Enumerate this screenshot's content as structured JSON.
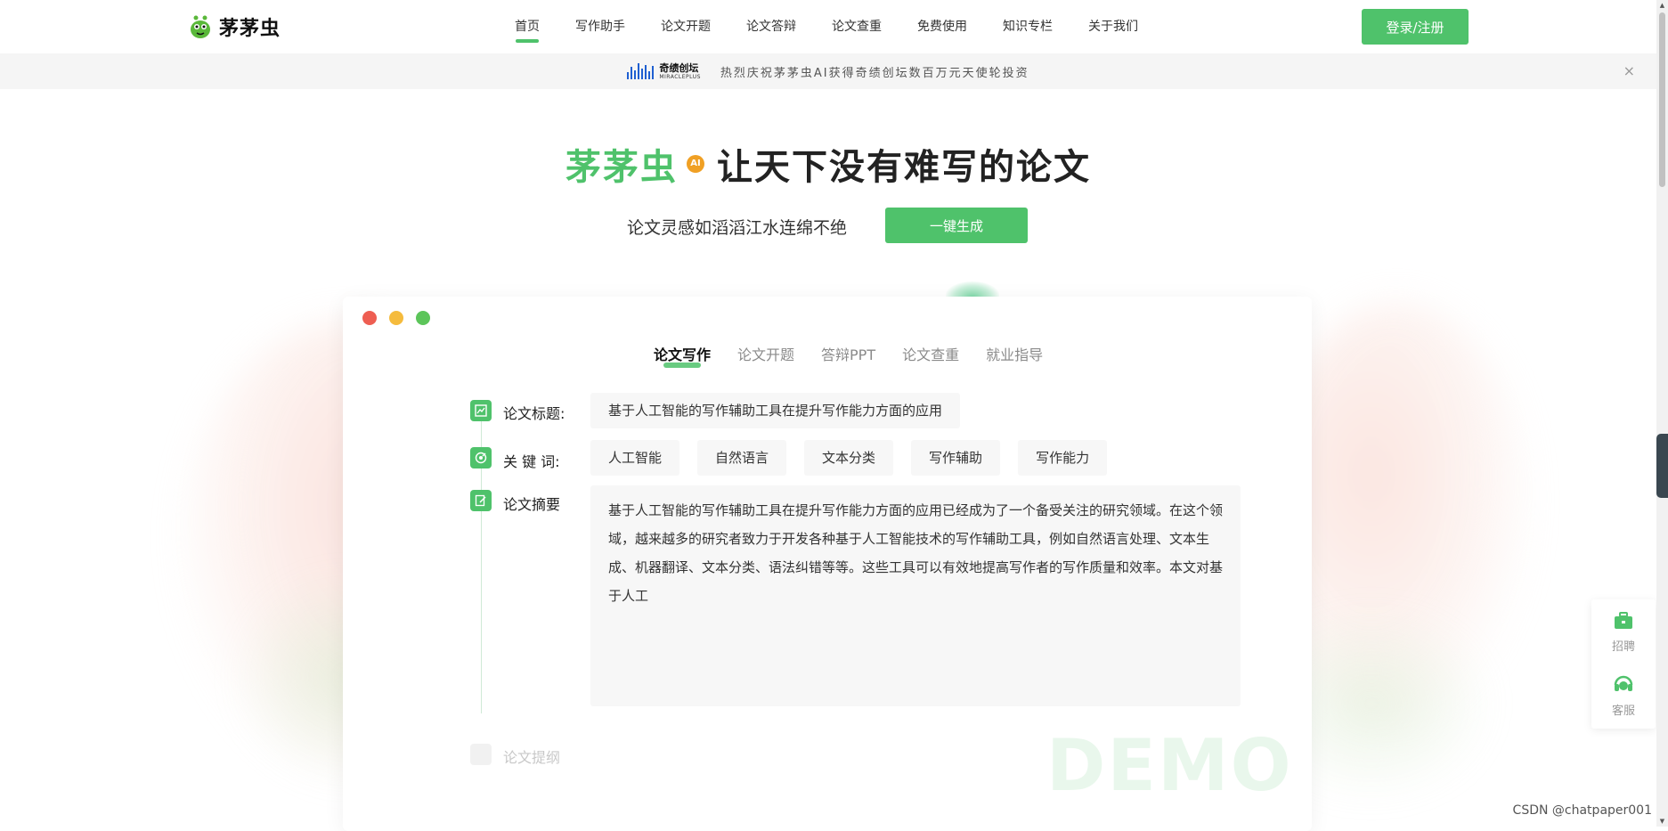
{
  "logo": {
    "text": "茅茅虫",
    "icon": "caterpillar-logo-icon"
  },
  "nav": {
    "items": [
      {
        "label": "首页",
        "active": true
      },
      {
        "label": "写作助手"
      },
      {
        "label": "论文开题"
      },
      {
        "label": "论文答辩"
      },
      {
        "label": "论文查重"
      },
      {
        "label": "免费使用"
      },
      {
        "label": "知识专栏"
      },
      {
        "label": "关于我们"
      }
    ],
    "login_label": "登录/注册"
  },
  "announcement": {
    "partner_cn": "奇绩创坛",
    "partner_en": "MIRACLEPLUS",
    "text": "热烈庆祝茅茅虫AI获得奇绩创坛数百万元天使轮投资",
    "close": "×"
  },
  "hero": {
    "brand": "茅茅虫",
    "badge": "AI",
    "slogan": "让天下没有难写的论文",
    "subtitle": "论文灵感如滔滔江水连绵不绝",
    "generate_label": "一键生成"
  },
  "demo": {
    "tabs": [
      {
        "label": "论文写作",
        "active": true
      },
      {
        "label": "论文开题"
      },
      {
        "label": "答辩PPT"
      },
      {
        "label": "论文查重"
      },
      {
        "label": "就业指导"
      }
    ],
    "title_label": "论文标题:",
    "title_value": "基于人工智能的写作辅助工具在提升写作能力方面的应用",
    "keywords_label": "关 键 词:",
    "keywords": [
      "人工智能",
      "自然语言",
      "文本分类",
      "写作辅助",
      "写作能力"
    ],
    "abstract_label": "论文摘要",
    "abstract_text": "基于人工智能的写作辅助工具在提升写作能力方面的应用已经成为了一个备受关注的研究领域。在这个领域，越来越多的研究者致力于开发各种基于人工智能技术的写作辅助工具，例如自然语言处理、文本生成、机器翻译、文本分类、语法纠错等等。这些工具可以有效地提高写作者的写作质量和效率。本文对基于人工",
    "outline_label": "论文提纲",
    "watermark": "DEMO"
  },
  "float_panel": {
    "recruit_label": "招聘",
    "service_label": "客服"
  },
  "footer_watermark": "CSDN @chatpaper001",
  "colors": {
    "accent": "#4fc26b",
    "badge": "#f0a024",
    "dot_red": "#ee5e52",
    "dot_yellow": "#f5bb3d",
    "dot_green": "#5cc55a"
  }
}
